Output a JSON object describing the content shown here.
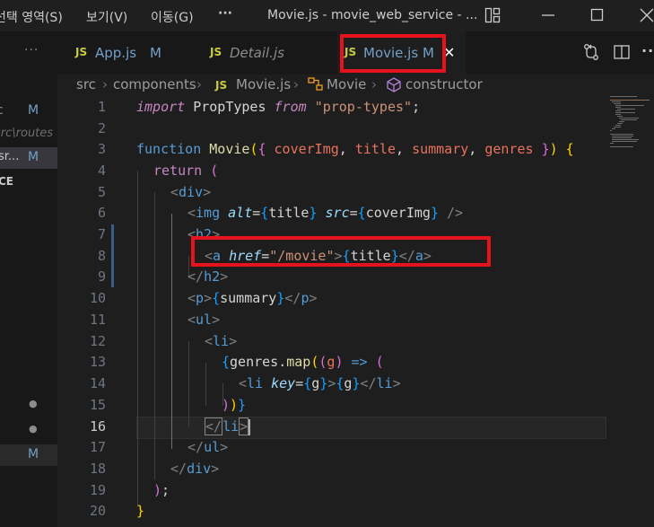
{
  "titlebar": {
    "menus": [
      "선택 영역(S)",
      "보기(V)",
      "이동(G)",
      "···"
    ],
    "window_title": "Movie.js - movie_web_service - ...",
    "icons": [
      "layout-icon",
      "minimize-icon",
      "maximize-icon",
      "close-icon"
    ]
  },
  "sidebar": {
    "more": "···",
    "rows": [
      {
        "text": "c",
        "badge": "M"
      },
      {
        "text": "src\\routes",
        "badge": ""
      },
      {
        "text": "sr...",
        "badge": "M"
      },
      {
        "text": "CE",
        "badge": ""
      }
    ],
    "dots": [
      "●",
      "●"
    ],
    "bottom_badge": "M"
  },
  "tabs": [
    {
      "icon": "JS",
      "name": "App.js",
      "mod": "M"
    },
    {
      "icon": "JS",
      "name": "Detail.js",
      "mod": ""
    },
    {
      "icon": "JS",
      "name": "Movie.js",
      "mod": "M",
      "close": "✕"
    }
  ],
  "breadcrumbs": [
    "src",
    "components",
    "JS",
    "Movie.js",
    "Movie",
    "constructor"
  ],
  "line_numbers": [
    "1",
    "2",
    "3",
    "4",
    "5",
    "6",
    "7",
    "8",
    "9",
    "10",
    "11",
    "12",
    "13",
    "14",
    "15",
    "16",
    "17",
    "18",
    "19",
    "20"
  ],
  "code": {
    "l1": {
      "import": "import",
      "name": "PropTypes",
      "from": "from",
      "str": "\"prop-types\"",
      "semi": ";"
    },
    "l3": {
      "kw": "function",
      "fn": "Movie",
      "open": "(",
      "brace": "{",
      "p1": "coverImg",
      "c1": ",",
      "p2": "title",
      "c2": ",",
      "p3": "summary",
      "c3": ",",
      "p4": "genres",
      "cbrace": "}",
      "close": ")",
      "body": "{"
    },
    "l4": {
      "kw": "return",
      "paren": "("
    },
    "l5": {
      "lt": "<",
      "tag": "div",
      "gt": ">"
    },
    "l6": {
      "lt": "<",
      "tag": "img",
      "a1": "alt",
      "eq1": "=",
      "v1": "title",
      "a2": "src",
      "eq2": "=",
      "v2": "coverImg",
      "end": "/>"
    },
    "l7": {
      "lt": "<",
      "tag": "h2",
      "gt": ">"
    },
    "l8": {
      "lt": "<",
      "tag": "a",
      "attr": "href",
      "eq": "=",
      "str": "\"/movie\"",
      "gt": ">",
      "ob": "{",
      "var": "title",
      "cb": "}",
      "close": "</",
      "ctag": "a",
      "cgt": ">"
    },
    "l9": {
      "close": "</",
      "tag": "h2",
      "gt": ">"
    },
    "l10": {
      "lt": "<",
      "tag": "p",
      "gt": ">",
      "ob": "{",
      "var": "summary",
      "cb": "}",
      "close": "</",
      "ctag": "p",
      "cgt": ">"
    },
    "l11": {
      "lt": "<",
      "tag": "ul",
      "gt": ">"
    },
    "l12": {
      "lt": "<",
      "tag": "li",
      "gt": ">"
    },
    "l13": {
      "ob": "{",
      "var": "genres",
      "dot": ".",
      "fn": "map",
      "p1": "(",
      "p2": "(",
      "g": "g",
      "p3": ")",
      "arrow": "=>",
      "p4": "("
    },
    "l14": {
      "lt": "<",
      "tag": "li",
      "attr": "key",
      "eq": "=",
      "ob": "{",
      "var": "g",
      "cb": "}",
      "gt": ">",
      "ob2": "{",
      "var2": "g",
      "cb2": "}",
      "close": "</",
      "ctag": "li",
      "cgt": ">"
    },
    "l15": {
      "p1": ")",
      "p2": ")",
      "cb": "}"
    },
    "l16": {
      "close": "</",
      "tag": "li",
      "gt": ">"
    },
    "l17": {
      "close": "</",
      "tag": "ul",
      "gt": ">"
    },
    "l18": {
      "close": "</",
      "tag": "div",
      "gt": ">"
    },
    "l19": {
      "paren": ")",
      "semi": ";"
    },
    "l20": {
      "brace": "}"
    }
  },
  "colors": {
    "highlight_box": "#e5141c",
    "background": "#1e1e1e"
  }
}
